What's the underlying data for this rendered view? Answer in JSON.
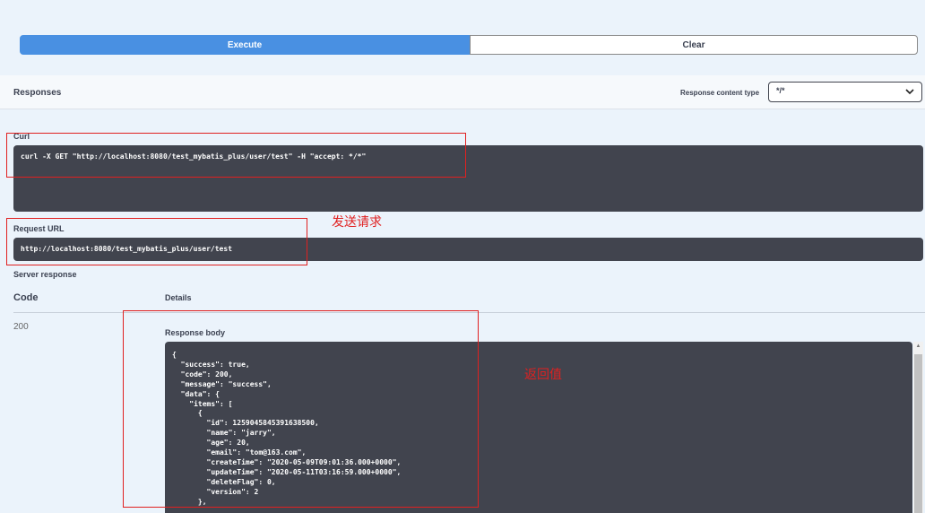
{
  "actions": {
    "execute_label": "Execute",
    "clear_label": "Clear"
  },
  "responses": {
    "title": "Responses",
    "content_type_label": "Response content type",
    "content_type_value": "*/*"
  },
  "curl": {
    "label": "Curl",
    "command": "curl -X GET \"http://localhost:8080/test_mybatis_plus/user/test\" -H \"accept: */*\""
  },
  "request_url": {
    "label": "Request URL",
    "value": "http://localhost:8080/test_mybatis_plus/user/test"
  },
  "server_response": {
    "label": "Server response",
    "code_header": "Code",
    "details_header": "Details",
    "status_code": "200",
    "body_label": "Response body",
    "body": "{\n  \"success\": true,\n  \"code\": 200,\n  \"message\": \"success\",\n  \"data\": {\n    \"items\": [\n      {\n        \"id\": 1259045845391638500,\n        \"name\": \"jarry\",\n        \"age\": 20,\n        \"email\": \"tom@163.com\",\n        \"createTime\": \"2020-05-09T09:01:36.000+0000\",\n        \"updateTime\": \"2020-05-11T03:16:59.000+0000\",\n        \"deleteFlag\": 0,\n        \"version\": 2\n      },"
  },
  "annotations": {
    "send_request": "发送请求",
    "return_value": "返回值",
    "color": "#e02020"
  },
  "icons": {
    "select_arrow": "chevron-down-icon",
    "scroll_up": "scroll-up-arrow-icon"
  }
}
